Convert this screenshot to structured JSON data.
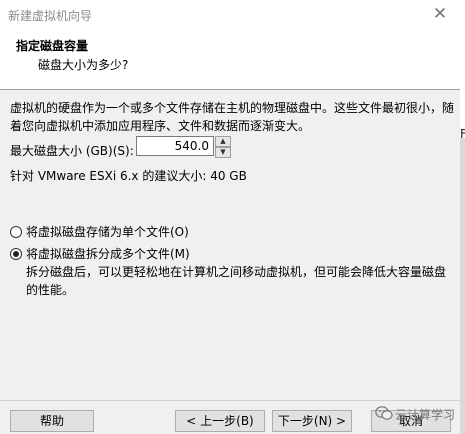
{
  "window": {
    "title": "新建虚拟机向导",
    "close_glyph": "✕"
  },
  "header": {
    "title": "指定磁盘容量",
    "subtitle": "磁盘大小为多少?"
  },
  "description": "虚拟机的硬盘作为一个或多个文件存储在主机的物理磁盘中。这些文件最初很小，随着您向虚拟机中添加应用程序、文件和数据而逐渐变大。",
  "disk_size": {
    "label": "最大磁盘大小 (GB)(S):",
    "value": "540.0",
    "spin_up": "▲",
    "spin_down": "▼"
  },
  "recommended": "针对 VMware ESXi 6.x 的建议大小: 40 GB",
  "options": [
    {
      "label": "将虚拟磁盘存储为单个文件(O)",
      "checked": false
    },
    {
      "label": "将虚拟磁盘拆分成多个文件(M)",
      "checked": true
    }
  ],
  "split_note": "拆分磁盘后，可以更轻松地在计算机之间移动虚拟机，但可能会降低大容量磁盘的性能。",
  "buttons": {
    "help": "帮助",
    "back": "< 上一步(B)",
    "next": "下一步(N) >",
    "cancel": "取消"
  },
  "side_fragment": "F",
  "watermark": "云计算学习",
  "icons": {
    "watermark_icon": "wechat-icon"
  }
}
